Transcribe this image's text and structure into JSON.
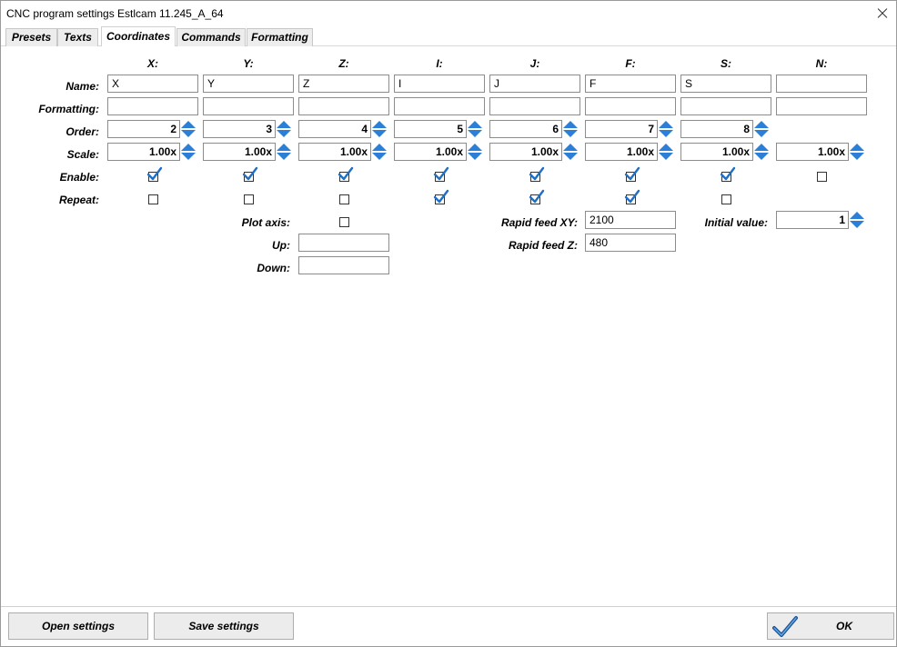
{
  "window": {
    "title": "CNC program settings Estlcam 11.245_A_64"
  },
  "tabs": [
    {
      "label": "Presets"
    },
    {
      "label": "Texts"
    },
    {
      "label": "Coordinates"
    },
    {
      "label": "Commands"
    },
    {
      "label": "Formatting"
    }
  ],
  "active_tab": "Coordinates",
  "row_labels": {
    "name": "Name:",
    "formatting": "Formatting:",
    "order": "Order:",
    "scale": "Scale:",
    "enable": "Enable:",
    "repeat": "Repeat:"
  },
  "columns": [
    {
      "header": "X:",
      "name": "X",
      "formatting": "",
      "order": "2",
      "scale": "1.00x",
      "enable": true,
      "repeat": false
    },
    {
      "header": "Y:",
      "name": "Y",
      "formatting": "",
      "order": "3",
      "scale": "1.00x",
      "enable": true,
      "repeat": false
    },
    {
      "header": "Z:",
      "name": "Z",
      "formatting": "",
      "order": "4",
      "scale": "1.00x",
      "enable": true,
      "repeat": false
    },
    {
      "header": "I:",
      "name": "I",
      "formatting": "",
      "order": "5",
      "scale": "1.00x",
      "enable": true,
      "repeat": true
    },
    {
      "header": "J:",
      "name": "J",
      "formatting": "",
      "order": "6",
      "scale": "1.00x",
      "enable": true,
      "repeat": true
    },
    {
      "header": "F:",
      "name": "F",
      "formatting": "",
      "order": "7",
      "scale": "1.00x",
      "enable": true,
      "repeat": true
    },
    {
      "header": "S:",
      "name": "S",
      "formatting": "",
      "order": "8",
      "scale": "1.00x",
      "enable": true,
      "repeat": false
    },
    {
      "header": "N:",
      "name": "",
      "formatting": "",
      "order": null,
      "scale": "1.00x",
      "enable": false,
      "repeat": null
    }
  ],
  "plot": {
    "plot_axis_label": "Plot axis:",
    "plot_axis_checked": false,
    "up_label": "Up:",
    "up_value": "",
    "down_label": "Down:",
    "down_value": ""
  },
  "feeds": {
    "rapid_xy_label": "Rapid feed XY:",
    "rapid_xy_value": "2100",
    "rapid_z_label": "Rapid feed Z:",
    "rapid_z_value": "480"
  },
  "initial": {
    "label": "Initial value:",
    "value": "1"
  },
  "buttons": {
    "open_settings": "Open settings",
    "save_settings": "Save settings",
    "ok": "OK"
  },
  "colors": {
    "accent": "#2b7fd6",
    "tick": "#1f6fc5"
  },
  "icons": {
    "close": "close-icon",
    "spin": "spin-arrows-icon",
    "check": "checkmark-icon"
  }
}
